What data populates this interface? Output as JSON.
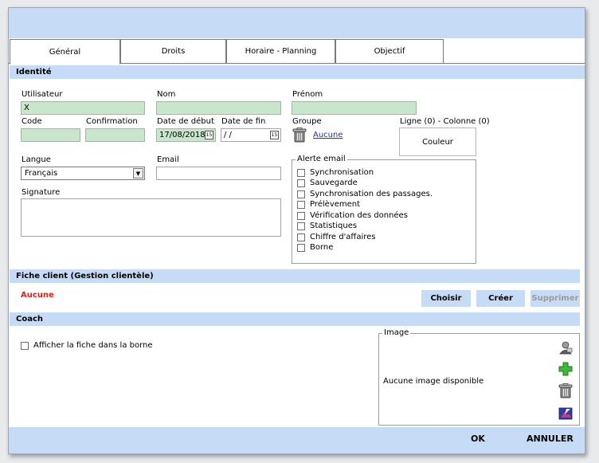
{
  "tabs": [
    "Général",
    "Droits",
    "Horaire - Planning",
    "Objectif"
  ],
  "identite": {
    "title": "Identité",
    "utilisateur": {
      "label": "Utilisateur",
      "value": "X"
    },
    "nom": {
      "label": "Nom",
      "value": ""
    },
    "prenom": {
      "label": "Prénom",
      "value": ""
    },
    "code": {
      "label": "Code",
      "value": ""
    },
    "confirmation": {
      "label": "Confirmation",
      "value": ""
    },
    "date_debut": {
      "label": "Date de début",
      "value": "17/08/2018"
    },
    "date_fin": {
      "label": "Date de fin",
      "value": "/ /"
    },
    "groupe": {
      "label": "Groupe",
      "value": "Aucune"
    },
    "ligne_colonne": "Ligne (0) - Colonne (0)",
    "couleur": "Couleur",
    "langue": {
      "label": "Langue",
      "value": "Français"
    },
    "email": {
      "label": "Email",
      "value": ""
    },
    "signature": {
      "label": "Signature"
    },
    "alerte": {
      "title": "Alerte email",
      "items": [
        "Synchronisation",
        "Sauvegarde",
        "Synchronisation des passages.",
        "Prélèvement",
        "Vérification des données",
        "Statistiques",
        "Chiffre d'affaires",
        "Borne"
      ]
    }
  },
  "fiche": {
    "title": "Fiche client (Gestion clientèle)",
    "value": "Aucune",
    "choisir": "Choisir",
    "creer": "Créer",
    "supprimer": "Supprimer"
  },
  "coach": {
    "title": "Coach",
    "afficher": "Afficher la fiche dans la borne",
    "image_title": "Image",
    "no_image": "Aucune image disponible"
  },
  "footer": {
    "ok": "OK",
    "annuler": "ANNULER"
  },
  "colors": {
    "accent": "#c6dcf6",
    "field_green": "#c9e5cb",
    "red": "#e0211b",
    "link": "#1a2fd0"
  }
}
